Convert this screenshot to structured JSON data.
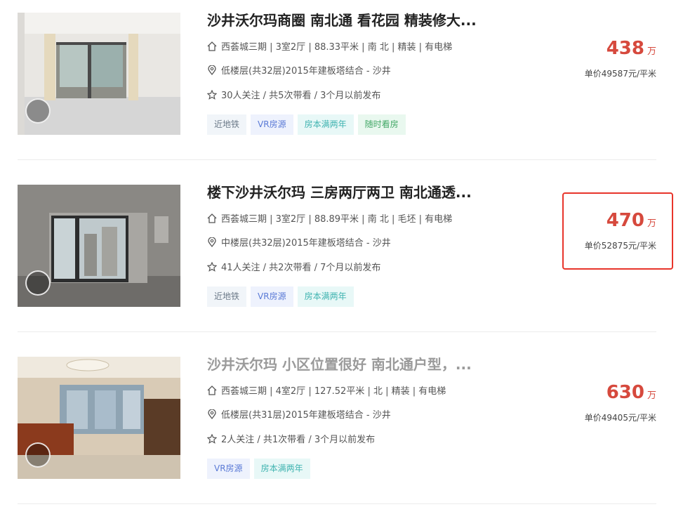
{
  "listings": [
    {
      "title": "沙井沃尔玛商圈 南北通 看花园 精装修大...",
      "info_house": "西荟城三期 | 3室2厅 | 88.33平米 | 南 北 | 精装 | 有电梯",
      "info_floor": "低楼层(共32层)2015年建板塔结合 - 沙井",
      "info_follow": "30人关注 / 共5次带看 / 3个月以前发布",
      "tags": [
        "近地铁",
        "VR房源",
        "房本满两年",
        "随时看房"
      ],
      "price": "438",
      "price_unit": "万",
      "unit_price": "单价49587元/平米"
    },
    {
      "title": "楼下沙井沃尔玛 三房两厅两卫 南北通透...",
      "info_house": "西荟城三期 | 3室2厅 | 88.89平米 | 南 北 | 毛坯 | 有电梯",
      "info_floor": "中楼层(共32层)2015年建板塔结合 - 沙井",
      "info_follow": "41人关注 / 共2次带看 / 7个月以前发布",
      "tags": [
        "近地铁",
        "VR房源",
        "房本满两年"
      ],
      "price": "470",
      "price_unit": "万",
      "unit_price": "单价52875元/平米"
    },
    {
      "title": "沙井沃尔玛 小区位置很好 南北通户型，...",
      "info_house": "西荟城三期 | 4室2厅 | 127.52平米 | 北 | 精装 | 有电梯",
      "info_floor": "低楼层(共31层)2015年建板塔结合 - 沙井",
      "info_follow": "2人关注 / 共1次带看 / 3个月以前发布",
      "tags": [
        "VR房源",
        "房本满两年"
      ],
      "price": "630",
      "price_unit": "万",
      "unit_price": "单价49405元/平米"
    }
  ],
  "icons": {
    "house": "house-icon",
    "location": "location-pin-icon",
    "follow": "star-icon",
    "vr": "vr-badge-icon"
  },
  "colors": {
    "price": "#d6493d",
    "highlight_border": "#e8352b"
  }
}
